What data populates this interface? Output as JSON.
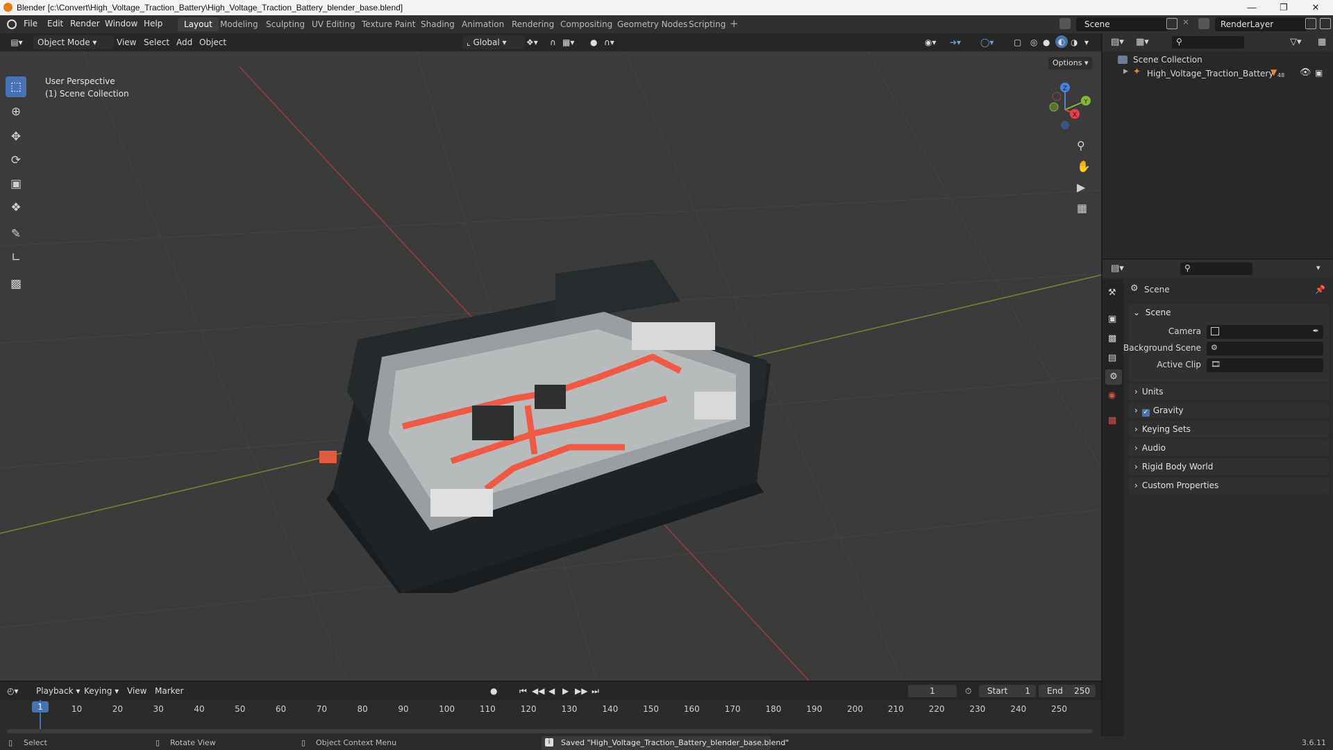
{
  "title_bar": {
    "title": "Blender [c:\\Convert\\High_Voltage_Traction_Battery\\High_Voltage_Traction_Battery_blender_base.blend]"
  },
  "menu": {
    "items": [
      "File",
      "Edit",
      "Render",
      "Window",
      "Help"
    ]
  },
  "workspaces": [
    "Layout",
    "Modeling",
    "Sculpting",
    "UV Editing",
    "Texture Paint",
    "Shading",
    "Animation",
    "Rendering",
    "Compositing",
    "Geometry Nodes",
    "Scripting"
  ],
  "top_right": {
    "scene": "Scene",
    "render_layer": "RenderLayer"
  },
  "viewport_header": {
    "mode": "Object Mode",
    "menus": [
      "View",
      "Select",
      "Add",
      "Object"
    ],
    "transform": "Global",
    "options": "Options"
  },
  "viewport": {
    "line1": "User Perspective",
    "line2": "(1) Scene Collection"
  },
  "gizmo": {
    "z": "Z",
    "y": "Y",
    "x": "X"
  },
  "outliner": {
    "root": "Scene Collection",
    "item": "High_Voltage_Traction_Battery",
    "item_badge": "48"
  },
  "properties": {
    "context": "Scene",
    "section": "Scene",
    "fields": [
      {
        "label": "Camera"
      },
      {
        "label": "Background Scene"
      },
      {
        "label": "Active Clip"
      }
    ],
    "panels": [
      "Units",
      "Gravity",
      "Keying Sets",
      "Audio",
      "Rigid Body World",
      "Custom Properties"
    ]
  },
  "timeline": {
    "menus": [
      "Playback",
      "Keying",
      "View",
      "Marker"
    ],
    "current_frame": "1",
    "start_label": "Start",
    "start": "1",
    "end_label": "End",
    "end": "250",
    "ruler": [
      "1",
      "10",
      "20",
      "30",
      "40",
      "50",
      "60",
      "70",
      "80",
      "90",
      "100",
      "110",
      "120",
      "130",
      "140",
      "150",
      "160",
      "170",
      "180",
      "190",
      "200",
      "210",
      "220",
      "230",
      "240",
      "250"
    ]
  },
  "statusbar": {
    "select": "Select",
    "rotate": "Rotate View",
    "context_menu": "Object Context Menu",
    "message": "Saved \"High_Voltage_Traction_Battery_blender_base.blend\"",
    "version": "3.6.11"
  }
}
